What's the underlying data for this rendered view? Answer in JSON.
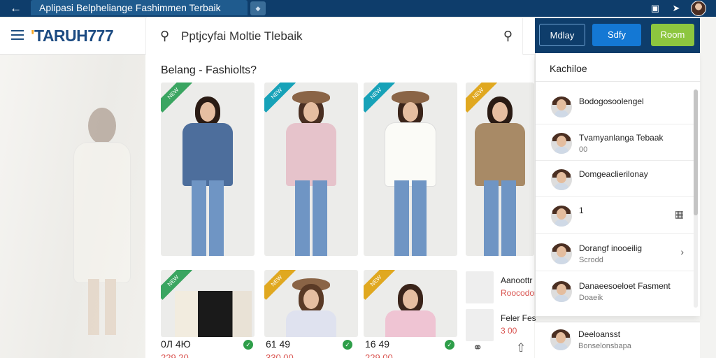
{
  "browser": {
    "tab_title": "Aplipasi Belpheliange Fashimmen Terbaik",
    "back_icon": "back-arrow-icon"
  },
  "header": {
    "logo_text": "TARUH777",
    "search_value": "Pptjcyfai Moltie Tlebaik",
    "actions": [
      "Mdlay",
      "Sdfy",
      "Room"
    ]
  },
  "main": {
    "section_title": "Belang - Fashiolts?",
    "products_row1": [
      {
        "badge": "NEW",
        "badge_color": "#3aa561"
      },
      {
        "badge": "NEW",
        "badge_color": "#17a2b8"
      },
      {
        "badge": "NEW",
        "badge_color": "#17a2b8"
      },
      {
        "badge": "NEW",
        "badge_color": "#e0a820"
      }
    ],
    "products_row2": [
      {
        "badge": "NEW",
        "price": "0Л 4Ю",
        "sub": "229 20"
      },
      {
        "badge": "NEW",
        "price": "61 49",
        "sub": "330 00"
      },
      {
        "badge": "NEW",
        "price": "16 49",
        "sub": "229 00"
      }
    ],
    "mini_items": [
      {
        "title": "Aanoottr",
        "price": "Roocodor"
      },
      {
        "title": "Feler Fes",
        "price": "3 00"
      }
    ]
  },
  "panel": {
    "title": "Kachiloe",
    "items": [
      {
        "name": "Bodogosoolengel",
        "sub": ""
      },
      {
        "name": "Tvamyanlanga Tebaak",
        "sub": "00"
      },
      {
        "name": "Domgeaclierilonay",
        "sub": ""
      },
      {
        "name": "1",
        "sub": ""
      },
      {
        "name": "Dorangf inooeilig",
        "sub": "Scrodd"
      },
      {
        "name": "Danaeesoeloet Fasment",
        "sub": "Doaeik"
      }
    ],
    "bottom": {
      "name": "Deeloansst",
      "sub": "Bonselonsbapa"
    }
  }
}
